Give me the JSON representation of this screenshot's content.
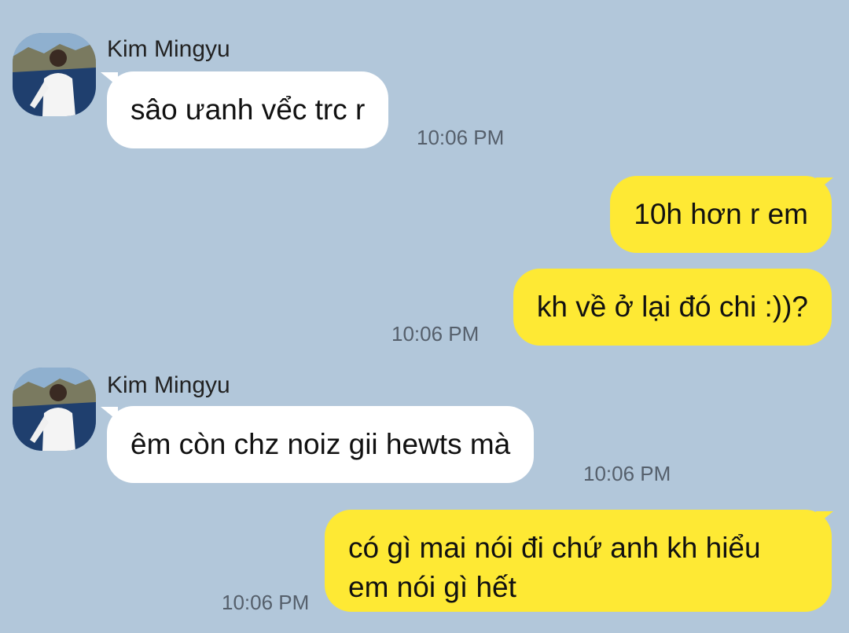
{
  "contact": {
    "name": "Kim Mingyu"
  },
  "messages": [
    {
      "direction": "in",
      "text": "sâo ưanh vểc trc r",
      "time": "10:06 PM"
    },
    {
      "direction": "out",
      "text": "10h hơn r em"
    },
    {
      "direction": "out",
      "text": "kh về ở lại đó chi :))?",
      "time": "10:06 PM"
    },
    {
      "direction": "in",
      "text": "êm còn chz noiz gii hewts mà",
      "time": "10:06 PM"
    },
    {
      "direction": "out",
      "text": "có gì mai nói đi chứ anh kh hiểu em nói gì hết",
      "time": "10:06 PM"
    }
  ],
  "colors": {
    "background": "#b2c7da",
    "incoming_bubble": "#ffffff",
    "outgoing_bubble": "#fee934"
  },
  "icons": {
    "avatar": "profile-photo"
  }
}
